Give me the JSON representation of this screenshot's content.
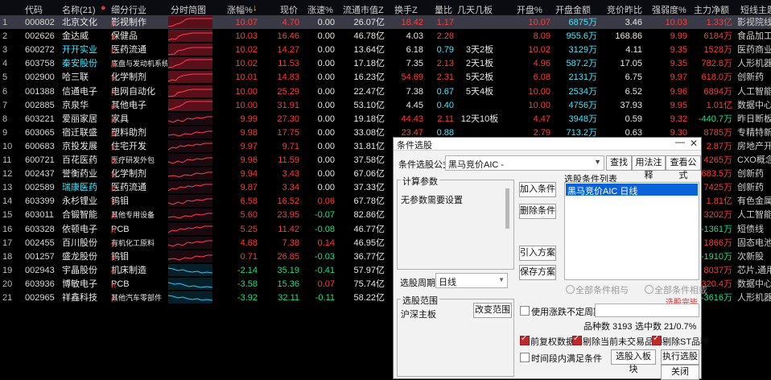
{
  "header": {
    "code": "代码",
    "name": "名称(21)",
    "sector": "细分行业",
    "chart": "分时简图",
    "chg": "涨幅%",
    "price": "现价",
    "speed": "涨速%",
    "mcap": "流通市值Z",
    "turnover": "换手Z",
    "vol_ratio": "量比",
    "days_boards": "几天几板",
    "open_pct": "开盘%",
    "open_amt": "开盘金额",
    "bid_ratio": "竞价昨比",
    "strength": "强弱度%",
    "main_net": "主力净额",
    "tag": "短线主题"
  },
  "rows": [
    {
      "idx": "1",
      "code": "000802",
      "name": "北京文化",
      "sector": "影视制作",
      "chg": "10.07",
      "price": "4.70",
      "speed": "0.00",
      "mcap": "26.07亿",
      "turn": "18.42",
      "vr": "1.17",
      "days": "",
      "open": "10.07",
      "amt": "6875万",
      "bid": "3.46",
      "str": "10.03",
      "net": "1.33亿",
      "tag": "影视院线",
      "spark": "up"
    },
    {
      "idx": "2",
      "code": "002626",
      "name": "金达威",
      "sector": "保健品",
      "chg": "10.03",
      "price": "16.46",
      "speed": "0.00",
      "mcap": "46.78亿",
      "turn": "4.03",
      "vr": "2.28",
      "days": "",
      "open": "8.09",
      "amt": "955.6万",
      "bid": "168.86",
      "str": "9.99",
      "net": "6184万",
      "tag": "食品加工",
      "spark": "up"
    },
    {
      "idx": "3",
      "code": "600272",
      "name": "开开实业",
      "sector": "医药流通",
      "chg": "10.02",
      "price": "14.27",
      "speed": "0.00",
      "mcap": "13.64亿",
      "turn": "6.18",
      "vr": "0.79",
      "days": "3天2板",
      "open": "10.02",
      "amt": "3129万",
      "bid": "4.11",
      "str": "9.35",
      "net": "1528万",
      "tag": "医药商业",
      "spark": "up"
    },
    {
      "idx": "4",
      "code": "603758",
      "name": "秦安股份",
      "sector": "底盘与发动机系统",
      "chg": "10.02",
      "price": "11.53",
      "speed": "0.00",
      "mcap": "17.18亿",
      "turn": "7.35",
      "vr": "2.13",
      "days": "2天1板",
      "open": "4.96",
      "amt": "587.2万",
      "bid": "17.05",
      "str": "9.35",
      "net": "782.8万",
      "tag": "人形机器人",
      "spark": "up"
    },
    {
      "idx": "5",
      "code": "002900",
      "name": "哈三联",
      "sector": "化学制剂",
      "chg": "10.01",
      "price": "14.83",
      "speed": "0.00",
      "mcap": "16.23亿",
      "turn": "54.69",
      "vr": "2.31",
      "days": "5天2板",
      "open": "6.08",
      "amt": "2131万",
      "bid": "6.75",
      "str": "9.97",
      "net": "618.0万",
      "tag": "创新药",
      "spark": "up"
    },
    {
      "idx": "6",
      "code": "001388",
      "name": "信通电子",
      "sector": "电网自动化",
      "chg": "10.00",
      "price": "25.29",
      "speed": "0.00",
      "mcap": "22.47亿",
      "turn": "7.38",
      "vr": "0.67",
      "days": "5天4板",
      "open": "10.00",
      "amt": "2534万",
      "bid": "6.52",
      "str": "9.96",
      "net": "6894万",
      "tag": "人工智能",
      "spark": "up"
    },
    {
      "idx": "7",
      "code": "002885",
      "name": "京泉华",
      "sector": "其他电子",
      "chg": "10.00",
      "price": "31.91",
      "speed": "0.00",
      "mcap": "53.10亿",
      "turn": "4.45",
      "vr": "0.40",
      "days": "",
      "open": "10.00",
      "amt": "4756万",
      "bid": "37.93",
      "str": "9.95",
      "net": "1.01亿",
      "tag": "数据中心",
      "spark": "up"
    },
    {
      "idx": "8",
      "code": "603221",
      "name": "爱丽家居",
      "sector": "家具",
      "chg": "9.99",
      "price": "27.30",
      "speed": "0.00",
      "mcap": "19.18亿",
      "turn": "44.43",
      "vr": "2.11",
      "days": "12天10板",
      "open": "4.47",
      "amt": "3948万",
      "bid": "0.59",
      "str": "9.32",
      "net": "-440.7万",
      "tag": "昨日断板",
      "spark": "mixed"
    },
    {
      "idx": "9",
      "code": "603065",
      "name": "宿迁联盛",
      "sector": "塑料助剂",
      "chg": "9.98",
      "price": "17.75",
      "speed": "0.00",
      "mcap": "33.08亿",
      "turn": "23.47",
      "vr": "0.88",
      "days": "",
      "open": "2.79",
      "amt": "713.2万",
      "bid": "0.63",
      "str": "9.30",
      "net": "8785万",
      "tag": "专精特新",
      "spark": "mixed"
    },
    {
      "idx": "10",
      "code": "600683",
      "name": "京投发展",
      "sector": "住宅开发",
      "chg": "9.97",
      "price": "9.71",
      "speed": "0.00",
      "mcap": "31.81亿",
      "net": "2.87万",
      "tag": "房地产开发",
      "spark": "mixed"
    },
    {
      "idx": "11",
      "code": "600721",
      "name": "百花医药",
      "sector": "医疗研发外包",
      "chg": "9.96",
      "price": "11.59",
      "speed": "0.00",
      "mcap": "37.58亿",
      "net": "4265万",
      "tag": "CXO概念",
      "spark": "mixed"
    },
    {
      "idx": "12",
      "code": "002437",
      "name": "誉衡药业",
      "sector": "化学制剂",
      "chg": "9.94",
      "price": "3.43",
      "speed": "0.00",
      "mcap": "67.06亿",
      "net": "683.5万",
      "tag": "创新药",
      "spark": "mixed"
    },
    {
      "idx": "13",
      "code": "002589",
      "name": "瑞康医药",
      "sector": "医药流通",
      "chg": "9.87",
      "price": "3.34",
      "speed": "0.00",
      "mcap": "37.33亿",
      "net": "7425万",
      "tag": "创新药",
      "spark": "mixed"
    },
    {
      "idx": "14",
      "code": "603399",
      "name": "永杉锂业",
      "sector": "钨钼",
      "chg": "6.58",
      "price": "16.52",
      "speed": "0.06",
      "mcap": "67.78亿",
      "net": "1.81亿",
      "tag": "有色金属",
      "spark": "mixed"
    },
    {
      "idx": "15",
      "code": "603011",
      "name": "合锻智能",
      "sector": "其他专用设备",
      "chg": "5.60",
      "price": "23.95",
      "speed": "-0.07",
      "mcap": "82.86亿",
      "net": "3202万",
      "tag": "人工智能",
      "spark": "mixed"
    },
    {
      "idx": "16",
      "code": "603328",
      "name": "依顿电子",
      "sector": "PCB",
      "chg": "5.25",
      "price": "11.42",
      "speed": "-0.08",
      "mcap": "46.77亿",
      "net": "-1361万",
      "tag": "短债线",
      "spark": "mixed"
    },
    {
      "idx": "17",
      "code": "002455",
      "name": "百川股份",
      "sector": "有机化工原料",
      "chg": "4.68",
      "price": "7.38",
      "speed": "0.14",
      "mcap": "46.95亿",
      "net": "1866万",
      "tag": "固态电池",
      "spark": "mixed"
    },
    {
      "idx": "18",
      "code": "001257",
      "name": "盛龙股份",
      "sector": "钨钼",
      "chg": "0.71",
      "price": "26.85",
      "speed": "-0.03",
      "mcap": "36.77亿",
      "net": "-1910万",
      "tag": "次新股",
      "spark": "mixed"
    },
    {
      "idx": "19",
      "code": "002943",
      "name": "宇晶股份",
      "sector": "机床制造",
      "chg": "-2.14",
      "price": "35.19",
      "speed": "-0.41",
      "mcap": "57.97亿",
      "net": "8037万",
      "tag": "芯片,通用",
      "spark": "down"
    },
    {
      "idx": "20",
      "code": "603936",
      "name": "博敏电子",
      "sector": "PCB",
      "chg": "-3.58",
      "price": "15.36",
      "speed": "0.07",
      "mcap": "75.74亿",
      "net": "320.4万",
      "tag": "数据中心",
      "spark": "down"
    },
    {
      "idx": "21",
      "code": "002965",
      "name": "祥鑫科技",
      "sector": "其他汽车零部件",
      "chg": "-3.92",
      "price": "32.11",
      "speed": "-0.11",
      "mcap": "58.22亿",
      "net": "-3616万",
      "tag": "人形机器人",
      "spark": "down"
    }
  ],
  "name_badges": {
    "2": "扶",
    "5": "扶",
    "6": "扶",
    "12": "扶",
    "14": "扶",
    "16": "扶",
    "17": "扶"
  },
  "dialog": {
    "title": "条件选股",
    "formula_label": "条件选股公式",
    "formula_value": "黑马竞价AIC -",
    "btn_find": "查找",
    "btn_usage": "用法注释",
    "btn_view": "查看公式",
    "calc_params_label": "计算参数",
    "no_params": "无参数需要设置",
    "btn_add": "加入条件",
    "btn_delete": "删除条件",
    "btn_import": "引入方案",
    "btn_save": "保存方案",
    "cond_list_label": "选股条件列表",
    "cond_item": "黑马竞价AIC  日线",
    "period_label": "选股周期:",
    "period_value": "日线",
    "radio_and": "全部条件相与",
    "radio_or": "全部条件相或",
    "done_text": "选股完毕",
    "scope_label": "选股范围",
    "scope_value": "沪深主板",
    "btn_change": "改变范围",
    "use_period": "使用涨跌不定周期",
    "count_text": "品种数 3193",
    "hit_text": "选中数 21/0.7%",
    "chk_fq": "前复权数据",
    "chk_no_trade": "剔除当前未交易品种",
    "chk_st": "剔除ST品种",
    "time_cond": "时间段内满足条件",
    "btn_to_block": "选股入板块",
    "btn_run": "执行选股",
    "btn_close": "关闭"
  }
}
